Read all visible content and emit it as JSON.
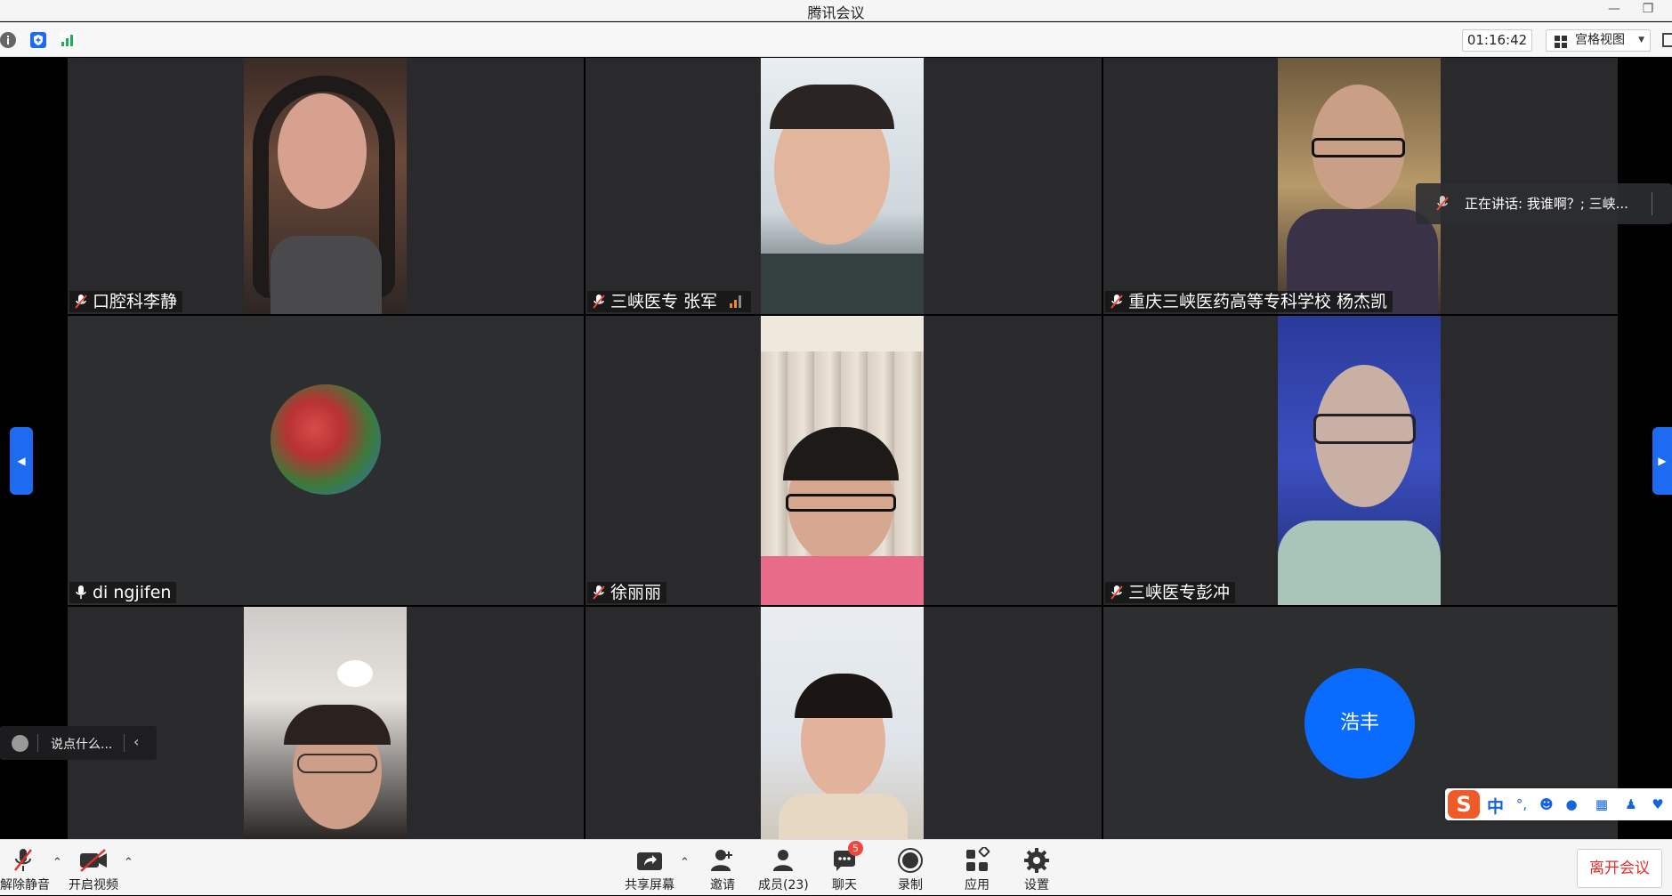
{
  "app": {
    "title": "腾讯会议"
  },
  "toolbar": {
    "timer": "01:16:42",
    "view_label": "宫格视图"
  },
  "participants": [
    {
      "name": "口腔科李静",
      "mic": "muted"
    },
    {
      "name": "三峡医专 张军",
      "mic": "muted",
      "signal": "weak"
    },
    {
      "name": "重庆三峡医药高等专科学校 杨杰凯",
      "mic": "muted"
    },
    {
      "name": "di ngjifen",
      "mic": "on"
    },
    {
      "name": "徐丽丽",
      "mic": "muted"
    },
    {
      "name": "三峡医专彭冲",
      "mic": "muted"
    },
    {
      "name": ""
    },
    {
      "name": ""
    },
    {
      "name": "浩丰",
      "avatar_text": "浩丰",
      "avatar_color": "#0a6cff"
    }
  ],
  "speaking": {
    "text": "正在讲话: 我谁啊？; 三峡..."
  },
  "chat_input": {
    "placeholder": "说点什么..."
  },
  "ime": {
    "mode": "中",
    "punct": "°,"
  },
  "controls": {
    "unmute": "解除静音",
    "start_video": "开启视频",
    "share_screen": "共享屏幕",
    "invite": "邀请",
    "members": "成员(23)",
    "chat": "聊天",
    "chat_badge": "5",
    "record": "录制",
    "apps": "应用",
    "settings": "设置",
    "leave": "离开会议"
  },
  "colors": {
    "accent": "#1c6bf0",
    "leave": "#e0302a",
    "signal": "#f08a24",
    "badge": "#f0463c"
  }
}
